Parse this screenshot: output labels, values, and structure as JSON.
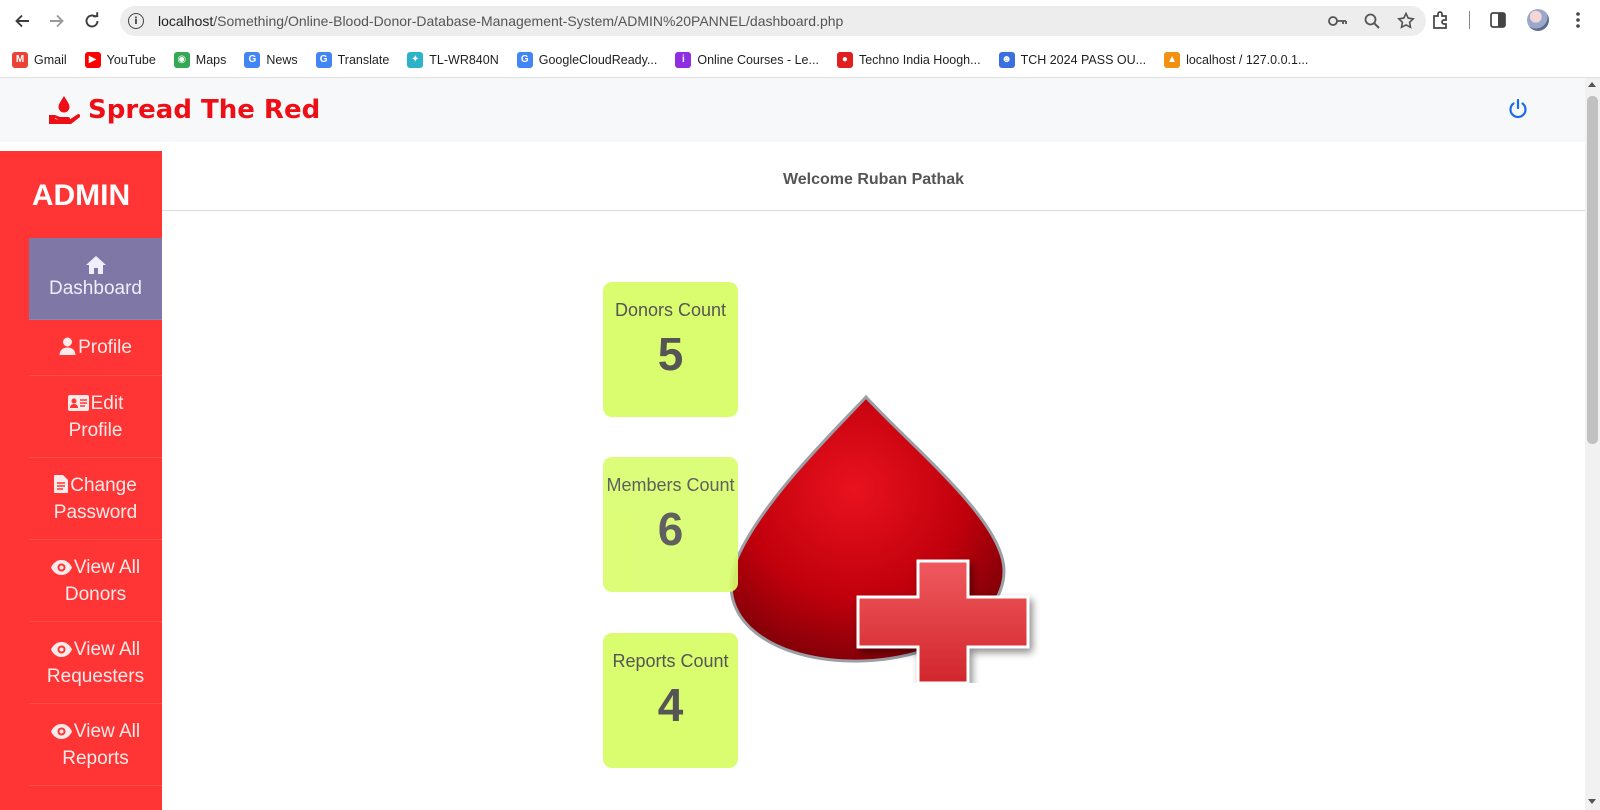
{
  "browser": {
    "url_host": "localhost",
    "url_path": "/Something/Online-Blood-Donor-Database-Management-System/ADMIN%20PANNEL/dashboard.php",
    "bookmarks": [
      {
        "label": "Gmail",
        "icon": "gmail-icon",
        "color": "#ea4335"
      },
      {
        "label": "YouTube",
        "icon": "youtube-icon",
        "color": "#ff0000"
      },
      {
        "label": "Maps",
        "icon": "maps-icon",
        "color": "#34a853"
      },
      {
        "label": "News",
        "icon": "news-icon",
        "color": "#4285f4"
      },
      {
        "label": "Translate",
        "icon": "translate-icon",
        "color": "#4285f4"
      },
      {
        "label": "TL-WR840N",
        "icon": "tplink-icon",
        "color": "#2cb3c8"
      },
      {
        "label": "GoogleCloudReady...",
        "icon": "google-icon",
        "color": "#4285f4"
      },
      {
        "label": "Online Courses - Le...",
        "icon": "courses-icon",
        "color": "#8e2de2"
      },
      {
        "label": "Techno India Hoogh...",
        "icon": "techno-icon",
        "color": "#e02020"
      },
      {
        "label": "TCH 2024 PASS OU...",
        "icon": "group-icon",
        "color": "#3b6fe0"
      },
      {
        "label": "localhost / 127.0.0.1...",
        "icon": "phpmyadmin-icon",
        "color": "#f29111"
      }
    ]
  },
  "header": {
    "brand": "Spread The Red",
    "brand_color": "#ee0e15"
  },
  "sidebar": {
    "title": "ADMIN",
    "items": [
      {
        "label": "Dashboard",
        "icon": "home-icon",
        "active": true
      },
      {
        "label": "Profile",
        "icon": "user-icon",
        "active": false
      },
      {
        "label": "Edit Profile",
        "line1": "Edit",
        "line2": "Profile",
        "icon": "id-card-icon",
        "active": false
      },
      {
        "label": "Change Password",
        "line1": "Change",
        "line2": "Password",
        "icon": "document-icon",
        "active": false
      },
      {
        "label": "View All Donors",
        "line1": "View All",
        "line2": "Donors",
        "icon": "eye-icon",
        "active": false
      },
      {
        "label": "View All Requesters",
        "line1": "View All",
        "line2": "Requesters",
        "icon": "eye-icon",
        "active": false
      },
      {
        "label": "View All Reports",
        "line1": "View All",
        "line2": "Reports",
        "icon": "eye-icon",
        "active": false
      }
    ]
  },
  "main": {
    "welcome": "Welcome Ruban Pathak",
    "stats": [
      {
        "label": "Donors Count",
        "value": "5"
      },
      {
        "label": "Members Count",
        "value": "6"
      },
      {
        "label": "Reports Count",
        "value": "4"
      }
    ],
    "card_color": "#dafd6f"
  }
}
